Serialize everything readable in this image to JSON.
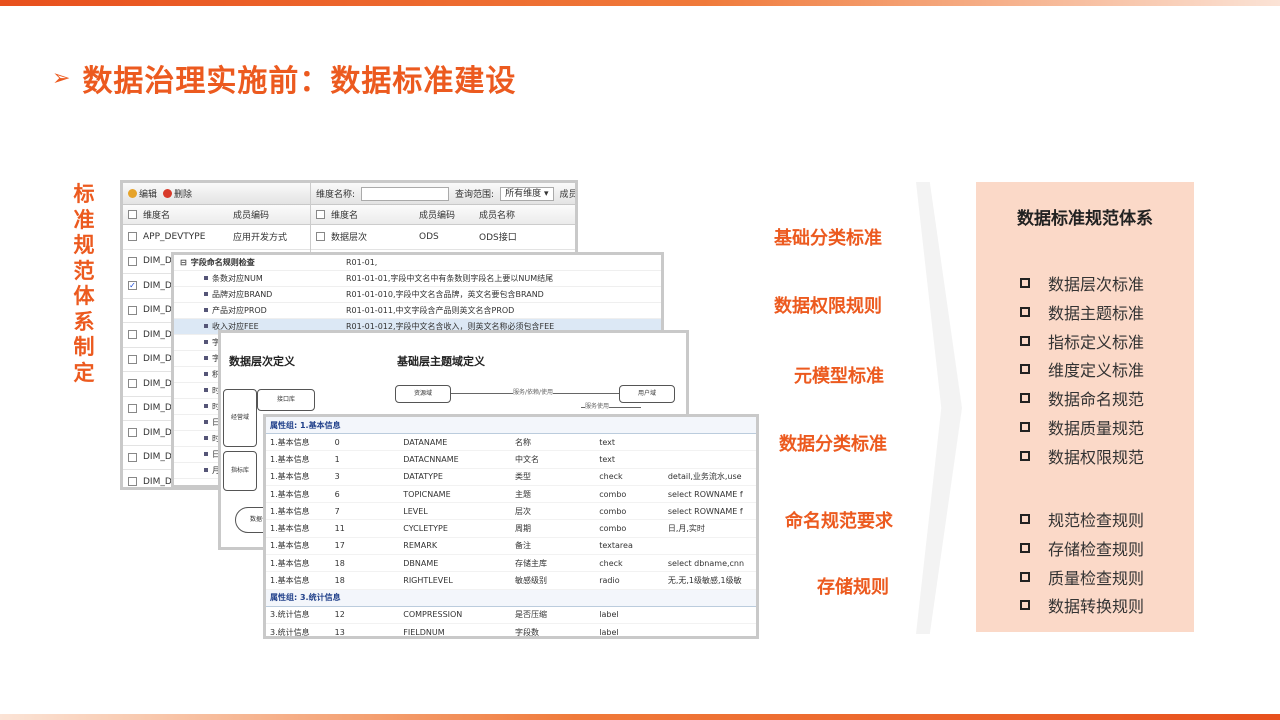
{
  "header": {
    "title": "数据治理实施前：数据标准建设"
  },
  "vertical_title": [
    "标",
    "准",
    "规",
    "范",
    "体",
    "系",
    "制",
    "定"
  ],
  "labels": [
    "基础分类标准",
    "数据权限规则",
    "元模型标准",
    "数据分类标准",
    "命名规范要求",
    "存储规则"
  ],
  "standards": {
    "title": "数据标准规范体系",
    "group1": [
      "数据层次标准",
      "数据主题标准",
      "指标定义标准",
      "维度定义标准",
      "数据命名规范",
      "数据质量规范",
      "数据权限规范"
    ],
    "group2": [
      "规范检查规则",
      "存储检查规则",
      "质量检查规则",
      "数据转换规则"
    ]
  },
  "screen1": {
    "toolbar": {
      "edit": "编辑",
      "delete": "删除"
    },
    "left_headers": [
      "维度名",
      "成员编码"
    ],
    "left_rows": [
      {
        "name": "APP_DEVTYPE",
        "code": "应用开发方式",
        "checked": false
      },
      {
        "name": "DIM_DA",
        "code": "",
        "checked": false
      },
      {
        "name": "DIM_DA",
        "code": "",
        "checked": true
      },
      {
        "name": "DIM_DA",
        "code": "",
        "checked": false
      },
      {
        "name": "DIM_DA",
        "code": "",
        "checked": false
      },
      {
        "name": "DIM_DE",
        "code": "",
        "checked": false
      },
      {
        "name": "DIM_DO",
        "code": "",
        "checked": false
      },
      {
        "name": "DIM_DO",
        "code": "",
        "checked": false
      },
      {
        "name": "DIM_DO",
        "code": "",
        "checked": false
      },
      {
        "name": "DIM_DO",
        "code": "",
        "checked": false
      },
      {
        "name": "DIM_DO",
        "code": "",
        "checked": false
      }
    ],
    "filter": {
      "dim_label": "维度名称:",
      "scope_label": "查询范围:",
      "scope_value": "所有维度",
      "member_label": "成员名称"
    },
    "right_headers": [
      "维度名",
      "成员编码",
      "成员名称"
    ],
    "right_rows": [
      {
        "name": "数据层次",
        "code": "ODS",
        "desc": "ODS接口"
      }
    ]
  },
  "screen2": {
    "rows": [
      {
        "name": "字段命名规则检查",
        "desc": "R01-01,",
        "top": true,
        "sel": false
      },
      {
        "name": "条数对应NUM",
        "desc": "R01-01-01,字段中文名中有条数则字段名上要以NUM结尾",
        "top": false,
        "sel": false
      },
      {
        "name": "品牌对应BRAND",
        "desc": "R01-01-010,字段中文名含品牌，英文名要包含BRAND",
        "top": false,
        "sel": false
      },
      {
        "name": "产品对应PROD",
        "desc": "R01-01-011,中文字段含产品则英文名含PROD",
        "top": false,
        "sel": false
      },
      {
        "name": "收入对应FEE",
        "desc": "R01-01-012,字段中文名含收入，则英文名称必须包含FEE",
        "top": false,
        "sel": true
      },
      {
        "name": "字",
        "desc": "",
        "top": false,
        "sel": false
      },
      {
        "name": "字",
        "desc": "",
        "top": false,
        "sel": false
      },
      {
        "name": "积",
        "desc": "",
        "top": false,
        "sel": false
      },
      {
        "name": "时",
        "desc": "",
        "top": false,
        "sel": false
      },
      {
        "name": "时",
        "desc": "",
        "top": false,
        "sel": false
      },
      {
        "name": "日",
        "desc": "",
        "top": false,
        "sel": false
      },
      {
        "name": "时",
        "desc": "",
        "top": false,
        "sel": false
      },
      {
        "name": "日",
        "desc": "",
        "top": false,
        "sel": false
      },
      {
        "name": "月",
        "desc": "",
        "top": false,
        "sel": false
      }
    ]
  },
  "screen3": {
    "left_title": "数据层次定义",
    "right_title": "基础层主题域定义",
    "nodes": {
      "interface": "接口库",
      "domain": "经营域",
      "index": "指标库",
      "resource": "资源域",
      "user": "用户域",
      "dw": "数据仓库",
      "edge1": "服务/依赖/使用",
      "edge2": "服务使用"
    }
  },
  "screen4": {
    "group1": "属性组: 1.基本信息",
    "rows": [
      [
        "1.基本信息",
        "0",
        "DATANAME",
        "名称",
        "text",
        ""
      ],
      [
        "1.基本信息",
        "1",
        "DATACNNAME",
        "中文名",
        "text",
        ""
      ],
      [
        "1.基本信息",
        "3",
        "DATATYPE",
        "类型",
        "check",
        "detail,业务流水,use"
      ],
      [
        "1.基本信息",
        "6",
        "TOPICNAME",
        "主题",
        "combo",
        "select ROWNAME f"
      ],
      [
        "1.基本信息",
        "7",
        "LEVEL",
        "层次",
        "combo",
        "select ROWNAME f"
      ],
      [
        "1.基本信息",
        "11",
        "CYCLETYPE",
        "周期",
        "combo",
        "日,月,实时"
      ],
      [
        "1.基本信息",
        "17",
        "REMARK",
        "备注",
        "textarea",
        ""
      ],
      [
        "1.基本信息",
        "18",
        "DBNAME",
        "存储主库",
        "check",
        "select dbname,cnn"
      ],
      [
        "1.基本信息",
        "18",
        "RIGHTLEVEL",
        "敏感级别",
        "radio",
        "无,无,1级敏感,1级敏"
      ]
    ],
    "group3": "属性组: 3.统计信息",
    "rows3": [
      [
        "3.统计信息",
        "12",
        "COMPRESSION",
        "是否压缩",
        "label",
        ""
      ],
      [
        "3.统计信息",
        "13",
        "FIELDNUM",
        "字段数",
        "label",
        ""
      ]
    ]
  }
}
